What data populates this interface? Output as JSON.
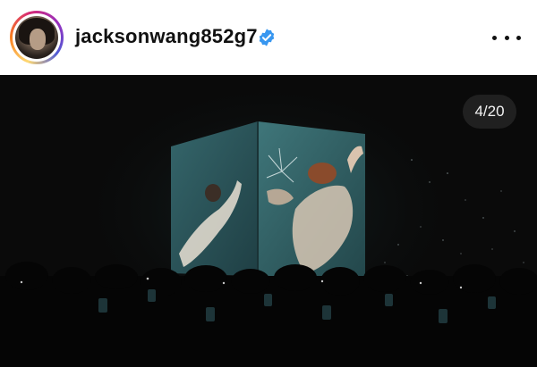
{
  "post": {
    "username": "jacksonwang852g7",
    "verified": true,
    "avatar_icon": "profile-avatar",
    "more_icon": "more-options-icon",
    "counter": "4/20"
  },
  "colors": {
    "verified_blue": "#3897f0",
    "story_ring": [
      "#feda75",
      "#fa7e1e",
      "#d62976",
      "#962fbf",
      "#4f5bd5"
    ],
    "photo_background": "#0a0a0a",
    "screen_teal": "#2f5a60"
  }
}
